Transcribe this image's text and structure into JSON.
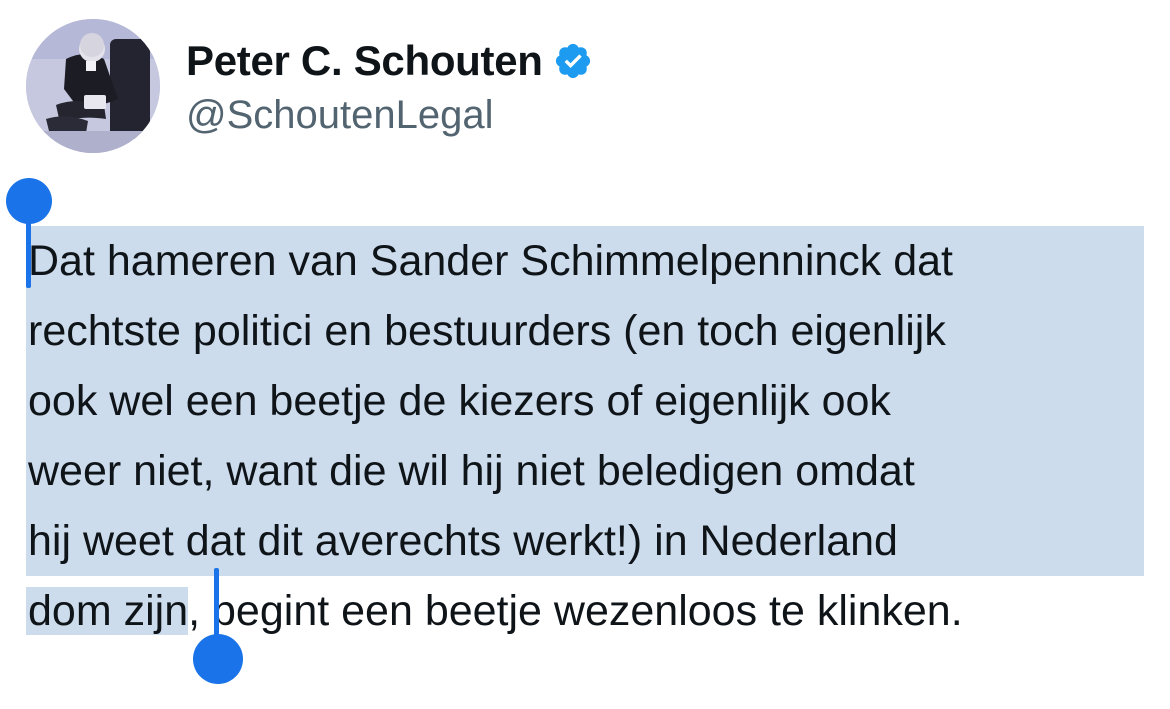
{
  "author": {
    "display_name": "Peter C. Schouten",
    "handle": "@SchoutenLegal",
    "verified": true,
    "verified_icon": "verified-badge-icon",
    "verified_color": "#1d9bf0"
  },
  "tweet": {
    "lines": [
      "Dat hameren van Sander Schimmelpenninck dat",
      "rechtste politici en bestuurders (en toch eigenlijk",
      "ook wel een beetje de kiezers of eigenlijk ook",
      "weer niet, want die wil hij niet beledigen omdat",
      "hij weet dat dit averechts werkt!) in Nederland"
    ],
    "last_line_selected": "dom zijn",
    "last_line_rest": ", begint een beetje wezenloos te klinken."
  },
  "selection": {
    "highlight_color": "#ccdcec",
    "handle_color": "#1a73e8"
  }
}
